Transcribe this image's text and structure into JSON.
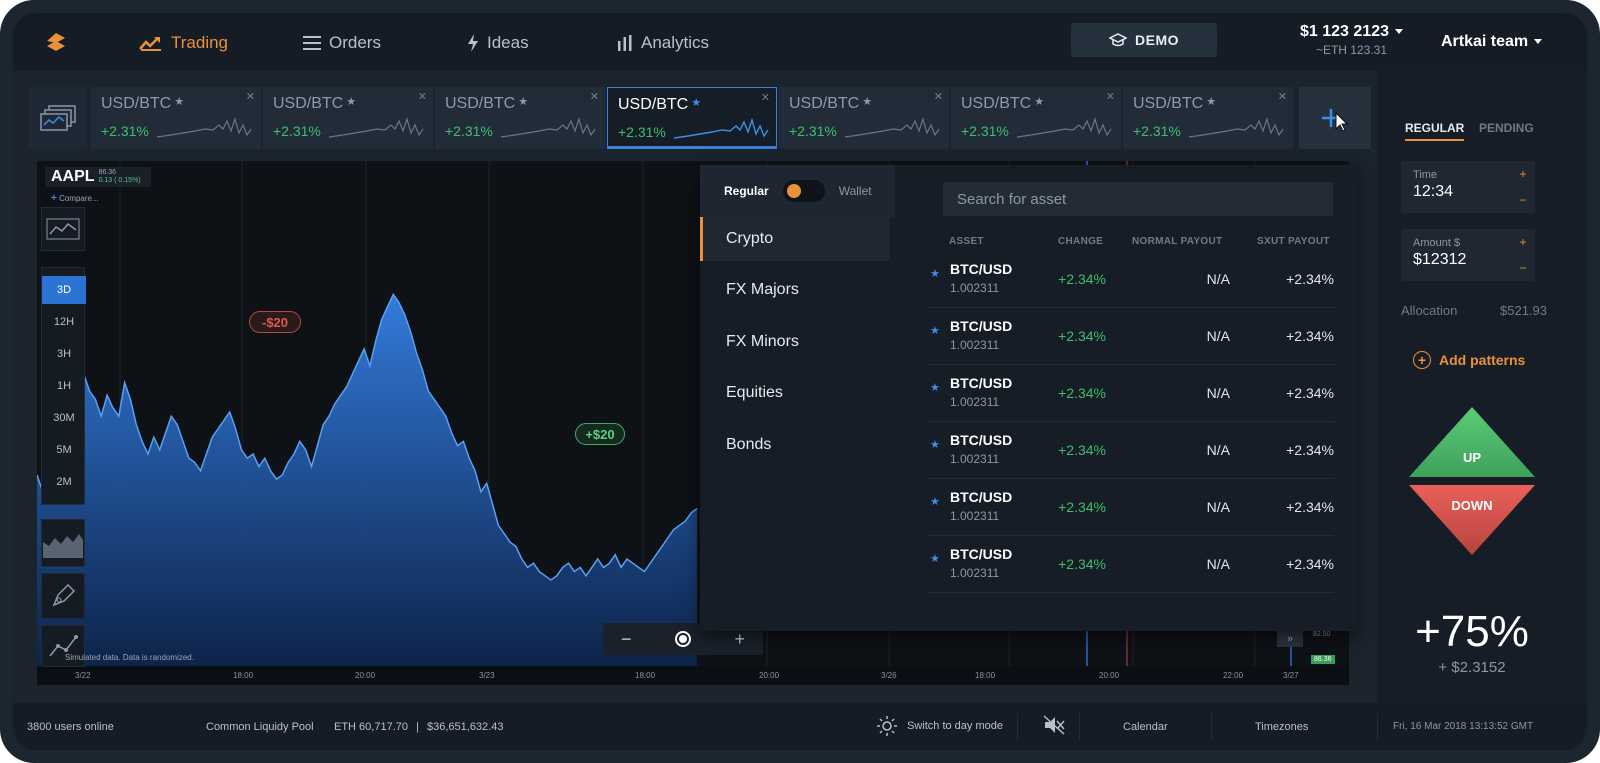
{
  "header": {
    "nav": [
      {
        "label": "Trading",
        "icon": "trending-icon",
        "active": true
      },
      {
        "label": "Orders",
        "icon": "menu-icon"
      },
      {
        "label": "Ideas",
        "icon": "lightning-icon"
      },
      {
        "label": "Analytics",
        "icon": "bar-chart-icon"
      }
    ],
    "demo_label": "DEMO",
    "balance": "$1 123 2123",
    "balance_eth": "~ETH 123.31",
    "team": "Artkai team"
  },
  "tabs": [
    {
      "pair": "USD/BTC",
      "change": "+2.31%"
    },
    {
      "pair": "USD/BTC",
      "change": "+2.31%"
    },
    {
      "pair": "USD/BTC",
      "change": "+2.31%"
    },
    {
      "pair": "USD/BTC",
      "change": "+2.31%",
      "active": true
    },
    {
      "pair": "USD/BTC",
      "change": "+2.31%"
    },
    {
      "pair": "USD/BTC",
      "change": "+2.31%"
    },
    {
      "pair": "USD/BTC",
      "change": "+2.31%"
    }
  ],
  "chart": {
    "symbol": "AAPL",
    "price": "86.36",
    "price_change": "0.13 ( 0.15%)",
    "compare_label": "Compare...",
    "timeframes": [
      "3D",
      "12H",
      "3H",
      "1H",
      "30M",
      "5M",
      "2M"
    ],
    "active_timeframe": "3D",
    "trade_neg": "-$20",
    "trade_pos": "+$20",
    "sim_note": "Simulated data. Data is randomized.",
    "x_labels": [
      "3/22",
      "18:00",
      "20:00",
      "3/23",
      "18:00",
      "20:00",
      "3/26",
      "18:00",
      "20:00",
      "22:00",
      "3/27"
    ],
    "right_price": "82.50",
    "right_price_current": "86.36",
    "zoom_minus": "−",
    "zoom_plus": "+",
    "ff_label": "»"
  },
  "chart_data": {
    "type": "area",
    "x": [
      0,
      1,
      2,
      3,
      4,
      5,
      6,
      7,
      8,
      9,
      10,
      11,
      12,
      13,
      14,
      15,
      16,
      17,
      18,
      19,
      20,
      21,
      22,
      23,
      24,
      25,
      26,
      27,
      28,
      29,
      30,
      31,
      32,
      33,
      34,
      35,
      36,
      37,
      38,
      39,
      40,
      41,
      42,
      43,
      44,
      45,
      46,
      47,
      48,
      49,
      50,
      51,
      52,
      53,
      54,
      55,
      56,
      57,
      58,
      59,
      60,
      61,
      62,
      63,
      64,
      65,
      66,
      67,
      68,
      69,
      70,
      71,
      72,
      73,
      74,
      75,
      76,
      77,
      78,
      79,
      80,
      81,
      82,
      83,
      84,
      85,
      86,
      87,
      88,
      89,
      90,
      91,
      92,
      93,
      94,
      95,
      96,
      97,
      98,
      99,
      100,
      101,
      102,
      103,
      104,
      105,
      106,
      107,
      108,
      109,
      110,
      111,
      112,
      113
    ],
    "values": [
      30,
      26,
      50,
      54,
      58,
      48,
      52,
      60,
      54,
      50,
      48,
      44,
      49,
      46,
      44,
      52,
      48,
      42,
      38,
      35,
      39,
      36,
      40,
      44,
      42,
      38,
      34,
      33,
      31,
      35,
      39,
      41,
      43,
      45,
      41,
      36,
      34,
      35,
      32,
      34,
      31,
      29,
      30,
      33,
      35,
      38,
      36,
      32,
      37,
      42,
      44,
      47,
      49,
      51,
      54,
      57,
      60,
      56,
      62,
      67,
      70,
      73,
      71,
      68,
      64,
      59,
      55,
      50,
      48,
      46,
      44,
      40,
      37,
      38,
      34,
      31,
      26,
      28,
      23,
      18,
      16,
      14,
      13,
      10,
      8,
      9,
      7,
      6,
      5,
      6,
      8,
      9,
      7,
      8,
      6,
      8,
      10,
      8,
      9,
      11,
      8,
      10,
      9,
      8,
      7,
      9,
      11,
      13,
      15,
      17,
      18,
      19,
      21,
      22
    ],
    "series": [
      {
        "values": []
      }
    ],
    "ylim": [
      0,
      100
    ],
    "grid": true
  },
  "assets": {
    "mode_regular": "Regular",
    "mode_wallet": "Wallet",
    "categories": [
      "Crypto",
      "FX Majors",
      "FX Minors",
      "Equities",
      "Bonds"
    ],
    "active_category": "Crypto",
    "search_placeholder": "Search for asset",
    "columns": [
      "ASSET",
      "CHANGE",
      "NORMAL PAYOUT",
      "SXUT PAYOUT"
    ],
    "rows": [
      {
        "name": "BTC/USD",
        "value": "1.002311",
        "change": "+2.34%",
        "normal": "N/A",
        "sxut": "+2.34%"
      },
      {
        "name": "BTC/USD",
        "value": "1.002311",
        "change": "+2.34%",
        "normal": "N/A",
        "sxut": "+2.34%"
      },
      {
        "name": "BTC/USD",
        "value": "1.002311",
        "change": "+2.34%",
        "normal": "N/A",
        "sxut": "+2.34%"
      },
      {
        "name": "BTC/USD",
        "value": "1.002311",
        "change": "+2.34%",
        "normal": "N/A",
        "sxut": "+2.34%"
      },
      {
        "name": "BTC/USD",
        "value": "1.002311",
        "change": "+2.34%",
        "normal": "N/A",
        "sxut": "+2.34%"
      },
      {
        "name": "BTC/USD",
        "value": "1.002311",
        "change": "+2.34%",
        "normal": "N/A",
        "sxut": "+2.34%"
      }
    ]
  },
  "order": {
    "tab_regular": "REGULAR",
    "tab_pending": "PENDING",
    "time_label": "Time",
    "time_value": "12:34",
    "amount_label": "Amount $",
    "amount_value": "$12312",
    "step_plus": "+",
    "step_minus": "−",
    "allocation_label": "Allocation",
    "allocation_value": "$521.93",
    "add_patterns": "Add patterns",
    "up_label": "UP",
    "down_label": "DOWN",
    "payout": "+75%",
    "payout_sub": "+ $2.3152"
  },
  "footer": {
    "users_online": "3800 users online",
    "pool": "Common Liquidy Pool",
    "eth": "ETH 60,717.70",
    "sep": "|",
    "usd": "$36,651,632.43",
    "day_mode": "Switch to day mode",
    "calendar": "Calendar",
    "timezones": "Timezones",
    "datetime": "Fri, 16 Mar 2018 13:13:52 GMT"
  },
  "colors": {
    "accent": "#e9913b",
    "positive": "#3fbe6b",
    "negative": "#e3594b",
    "chart_blue": "#2c74d4"
  }
}
